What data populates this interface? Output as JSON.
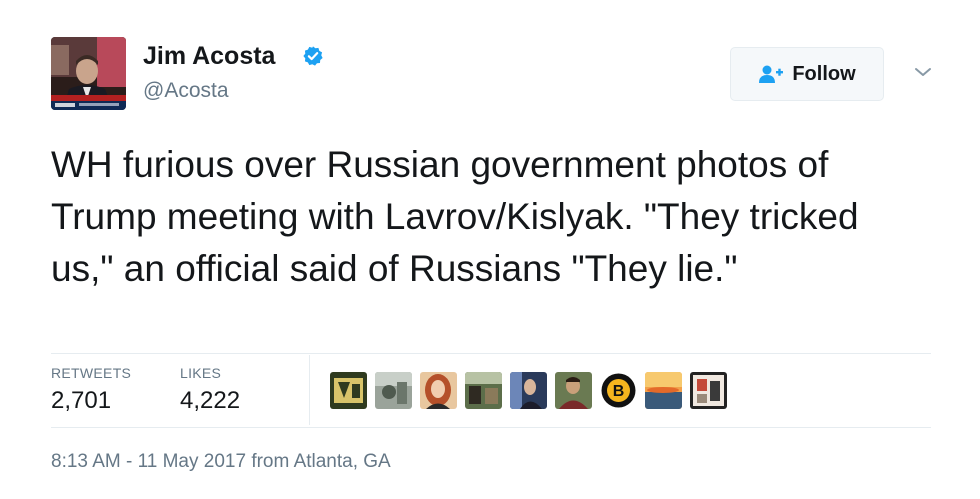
{
  "tweet": {
    "author": {
      "name": "Jim Acosta",
      "handle": "@Acosta",
      "verified_icon": "verified-badge-icon",
      "avatar_icon": "profile-photo"
    },
    "follow_button": {
      "label": "Follow",
      "icon": "add-user-icon"
    },
    "menu_icon": "chevron-down-icon",
    "text": "WH furious over Russian government photos of Trump meeting with Lavrov/Kislyak. \"They tricked us,\" an official said of Russians \"They lie.\"",
    "stats": {
      "retweets_label": "RETWEETS",
      "retweets_value": "2,701",
      "likes_label": "LIKES",
      "likes_value": "4,222"
    },
    "liker_avatars": [
      {
        "icon": "liker-avatar-1"
      },
      {
        "icon": "liker-avatar-2"
      },
      {
        "icon": "liker-avatar-3"
      },
      {
        "icon": "liker-avatar-4"
      },
      {
        "icon": "liker-avatar-5"
      },
      {
        "icon": "liker-avatar-6"
      },
      {
        "icon": "bruins-logo-avatar",
        "letter": "B"
      },
      {
        "icon": "liker-avatar-8"
      },
      {
        "icon": "liker-avatar-9"
      }
    ],
    "meta": {
      "time": "8:13 AM - 11 May 2017",
      "from_label": "from",
      "location": "Atlanta, GA"
    },
    "colors": {
      "text": "#14171a",
      "secondary": "#657786",
      "verified": "#1da1f2",
      "divider": "#e6ecf0"
    }
  }
}
